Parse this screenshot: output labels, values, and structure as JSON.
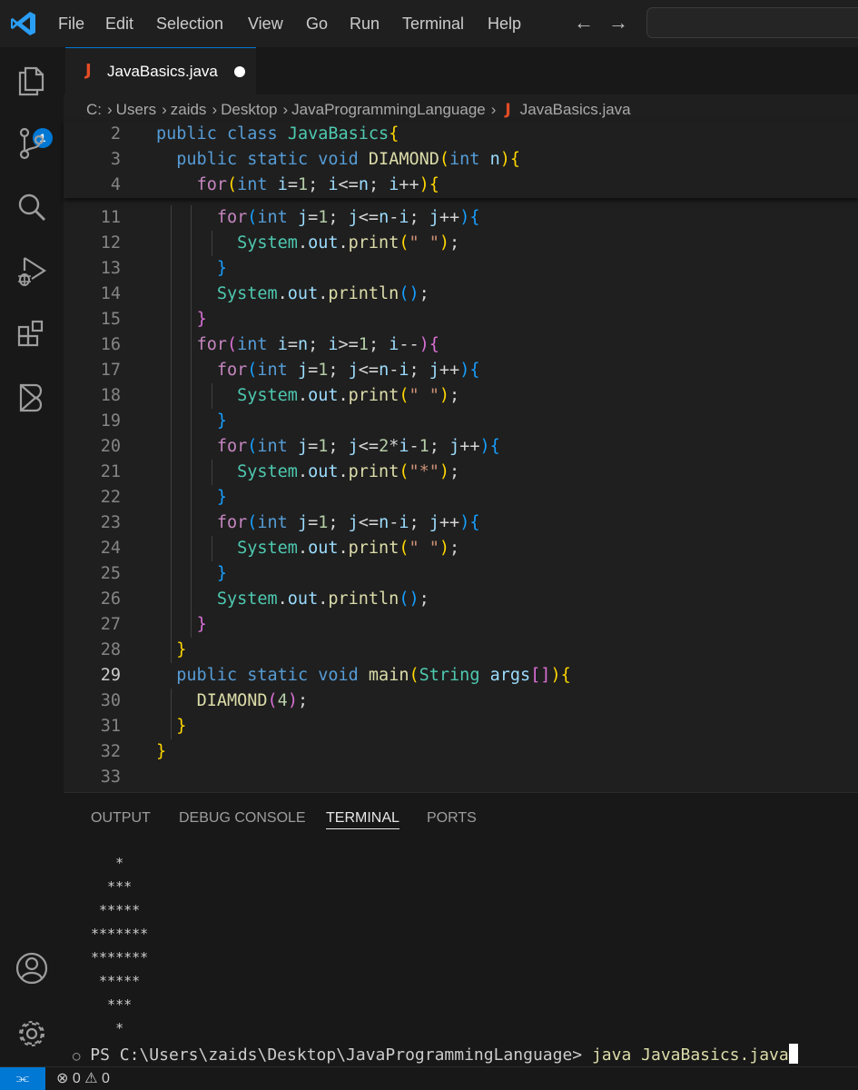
{
  "titlebar": {
    "menu": [
      "File",
      "Edit",
      "Selection",
      "View",
      "Go",
      "Run",
      "Terminal",
      "Help"
    ],
    "nav_back": "←",
    "nav_forward": "→"
  },
  "activitybar": {
    "explorer_badge": "1",
    "icons": [
      "explorer-icon",
      "source-control-icon",
      "search-icon",
      "run-debug-icon",
      "extensions-icon",
      "remote-icon",
      "account-icon",
      "settings-gear-icon"
    ]
  },
  "editor": {
    "tab": {
      "icon": "J",
      "label": "JavaBasics.java",
      "dirty": true
    },
    "breadcrumb": [
      "C:",
      "Users",
      "zaids",
      "Desktop",
      "JavaProgrammingLanguage",
      "JavaBasics.java"
    ],
    "breadcrumb_icon": "J",
    "sticky_lines": [
      {
        "n": "2",
        "code": "public class JavaBasics{"
      },
      {
        "n": "3",
        "code": "  public static void DIAMOND(int n){"
      },
      {
        "n": "4",
        "code": "    for(int i=1; i<=n; i++){"
      }
    ],
    "lines": [
      {
        "n": "11",
        "code": "      for(int j=1; j<=n-i; j++){"
      },
      {
        "n": "12",
        "code": "        System.out.print(\" \");"
      },
      {
        "n": "13",
        "code": "      }"
      },
      {
        "n": "14",
        "code": "      System.out.println();"
      },
      {
        "n": "15",
        "code": "    }"
      },
      {
        "n": "16",
        "code": "    for(int i=n; i>=1; i--){"
      },
      {
        "n": "17",
        "code": "      for(int j=1; j<=n-i; j++){"
      },
      {
        "n": "18",
        "code": "        System.out.print(\" \");"
      },
      {
        "n": "19",
        "code": "      }"
      },
      {
        "n": "20",
        "code": "      for(int j=1; j<=2*i-1; j++){"
      },
      {
        "n": "21",
        "code": "        System.out.print(\"*\");"
      },
      {
        "n": "22",
        "code": "      }"
      },
      {
        "n": "23",
        "code": "      for(int j=1; j<=n-i; j++){"
      },
      {
        "n": "24",
        "code": "        System.out.print(\" \");"
      },
      {
        "n": "25",
        "code": "      }"
      },
      {
        "n": "26",
        "code": "      System.out.println();"
      },
      {
        "n": "27",
        "code": "    }"
      },
      {
        "n": "28",
        "code": "  }"
      },
      {
        "n": "29",
        "code": "  public static void main(String args[]){"
      },
      {
        "n": "30",
        "code": "    DIAMOND(4);"
      },
      {
        "n": "31",
        "code": "  }"
      },
      {
        "n": "32",
        "code": "}"
      },
      {
        "n": "33",
        "code": ""
      }
    ],
    "current_line": "29"
  },
  "panel": {
    "tabs": [
      "OUTPUT",
      "DEBUG CONSOLE",
      "TERMINAL",
      "PORTS"
    ],
    "active_tab": "TERMINAL",
    "terminal_output": [
      "   *",
      "  ***",
      " *****",
      "*******",
      "*******",
      " *****",
      "  ***",
      "   *"
    ],
    "prompt_marker": "○",
    "prompt": "PS C:\\Users\\zaids\\Desktop\\JavaProgrammingLanguage> ",
    "command": "java JavaBasics.java"
  },
  "statusbar": {
    "remote_icon": "remote-connection-icon",
    "errors": "0",
    "warnings": "0"
  },
  "colors": {
    "accent": "#0078d4",
    "java_icon": "#e34c26",
    "keyword": "#569cd6",
    "control": "#c586c0",
    "function": "#dcdcaa",
    "type": "#4ec9b0",
    "variable": "#9cdcfe",
    "number": "#b5cea8",
    "string": "#ce9178"
  }
}
